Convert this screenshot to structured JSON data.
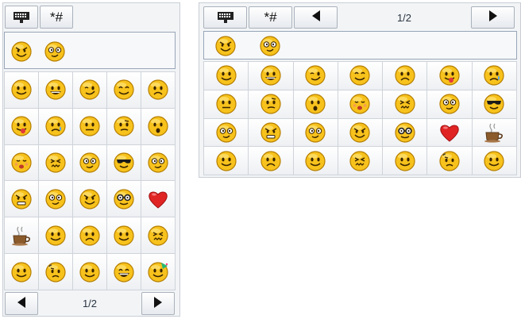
{
  "left_panel": {
    "tabs": [
      {
        "label": "",
        "icon": "keyboard-icon"
      },
      {
        "label": "*#",
        "icon": "symbols-icon"
      }
    ],
    "recent": [
      "grin-evil",
      "dizzy"
    ],
    "emoticons": [
      "smile",
      "grin",
      "wink",
      "happy",
      "sad",
      "tongue",
      "cry",
      "neutral",
      "skeptical",
      "surprised",
      "blush",
      "wince",
      "dizzy",
      "cool",
      "dizzy",
      "angry",
      "dizzy",
      "evil",
      "nerd",
      "heart",
      "coffee",
      "smile",
      "sad",
      "smile",
      "wince",
      "smile",
      "worried",
      "smile",
      "laugh",
      "party"
    ],
    "pager": {
      "page": "1/2",
      "prev": "prev-arrow-icon",
      "next": "next-arrow-icon"
    }
  },
  "right_panel": {
    "tabs": [
      {
        "label": "",
        "icon": "keyboard-icon"
      },
      {
        "label": "*#",
        "icon": "symbols-icon"
      }
    ],
    "pager": {
      "page": "1/2",
      "prev": "prev-arrow-icon",
      "next": "next-arrow-icon"
    },
    "recent": [
      "grin-evil",
      "dizzy"
    ],
    "emoticons": [
      "smile",
      "grin",
      "wink",
      "happy",
      "sad",
      "tongue",
      "cry",
      "neutral",
      "skeptical",
      "surprised",
      "blush",
      "wince",
      "dizzy",
      "cool",
      "dizzy",
      "angry",
      "dizzy",
      "evil",
      "nerd",
      "heart",
      "coffee",
      "smile",
      "sad",
      "smile",
      "wince",
      "smile",
      "worried",
      "smile"
    ]
  },
  "colors": {
    "face": "#f7c21c",
    "face_edge": "#b57e00",
    "heart": "#e02424",
    "accent": "#98a6b8"
  }
}
